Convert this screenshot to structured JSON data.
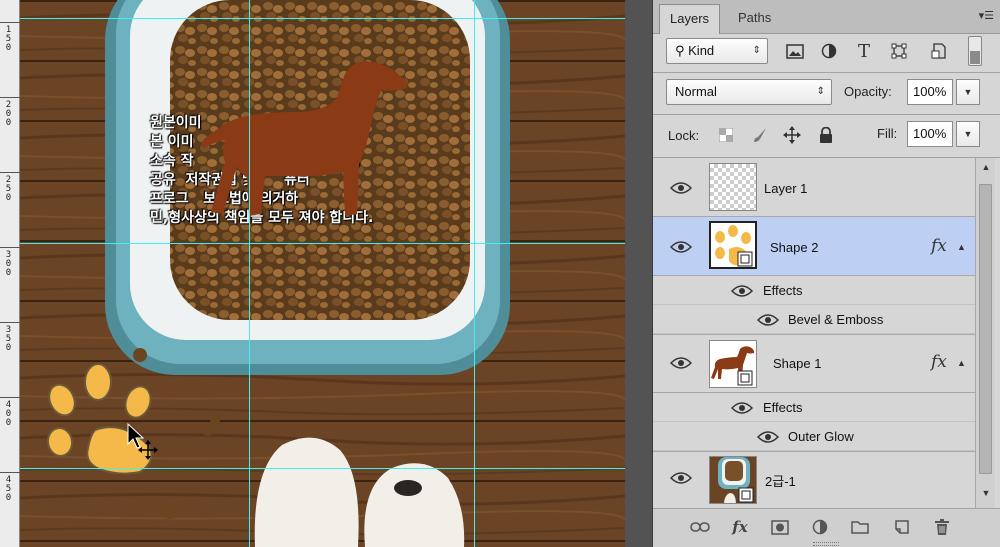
{
  "canvas": {
    "ruler_labels": [
      "150",
      "200",
      "250",
      "300",
      "350",
      "400",
      "450"
    ],
    "overlay_text": "원본이미                      권\n본 이미                     식재산권은\n소속 작                    제나 이미지\n공유  저작권법 및      퓨터\n프로그   보호법에 의거하\n민,형사상의 책임을 모두 져야 합니다."
  },
  "panel": {
    "tabs": [
      {
        "label": "Layers"
      },
      {
        "label": "Paths"
      }
    ],
    "menu_icon": "panel-menu-icon",
    "filter": {
      "value": "Kind"
    },
    "blend_mode": {
      "value": "Normal"
    },
    "opacity": {
      "label": "Opacity:",
      "value": "100%"
    },
    "lock": {
      "label": "Lock:"
    },
    "fill": {
      "label": "Fill:",
      "value": "100%"
    }
  },
  "layers": [
    {
      "name": "Layer 1",
      "visible": true,
      "selected": false,
      "has_fx": false
    },
    {
      "name": "Shape 2",
      "visible": true,
      "selected": true,
      "has_fx": true,
      "effects_label": "Effects",
      "effects": [
        "Bevel & Emboss"
      ]
    },
    {
      "name": "Shape 1",
      "visible": true,
      "selected": false,
      "has_fx": true,
      "effects_label": "Effects",
      "effects": [
        "Outer Glow"
      ]
    },
    {
      "name": "2급-1",
      "visible": true,
      "selected": false,
      "has_fx": false
    }
  ],
  "fx_label": "fx",
  "colors": {
    "selected_row": "#bdd0f3",
    "guide": "#3ff0f0",
    "dog_shape": "#8a3a14",
    "paw_shape": "#f5b94a"
  },
  "bottom_bar_icons": [
    "link-icon",
    "fx-icon",
    "mask-icon",
    "adjustment-icon",
    "folder-icon",
    "new-layer-icon",
    "trash-icon"
  ]
}
